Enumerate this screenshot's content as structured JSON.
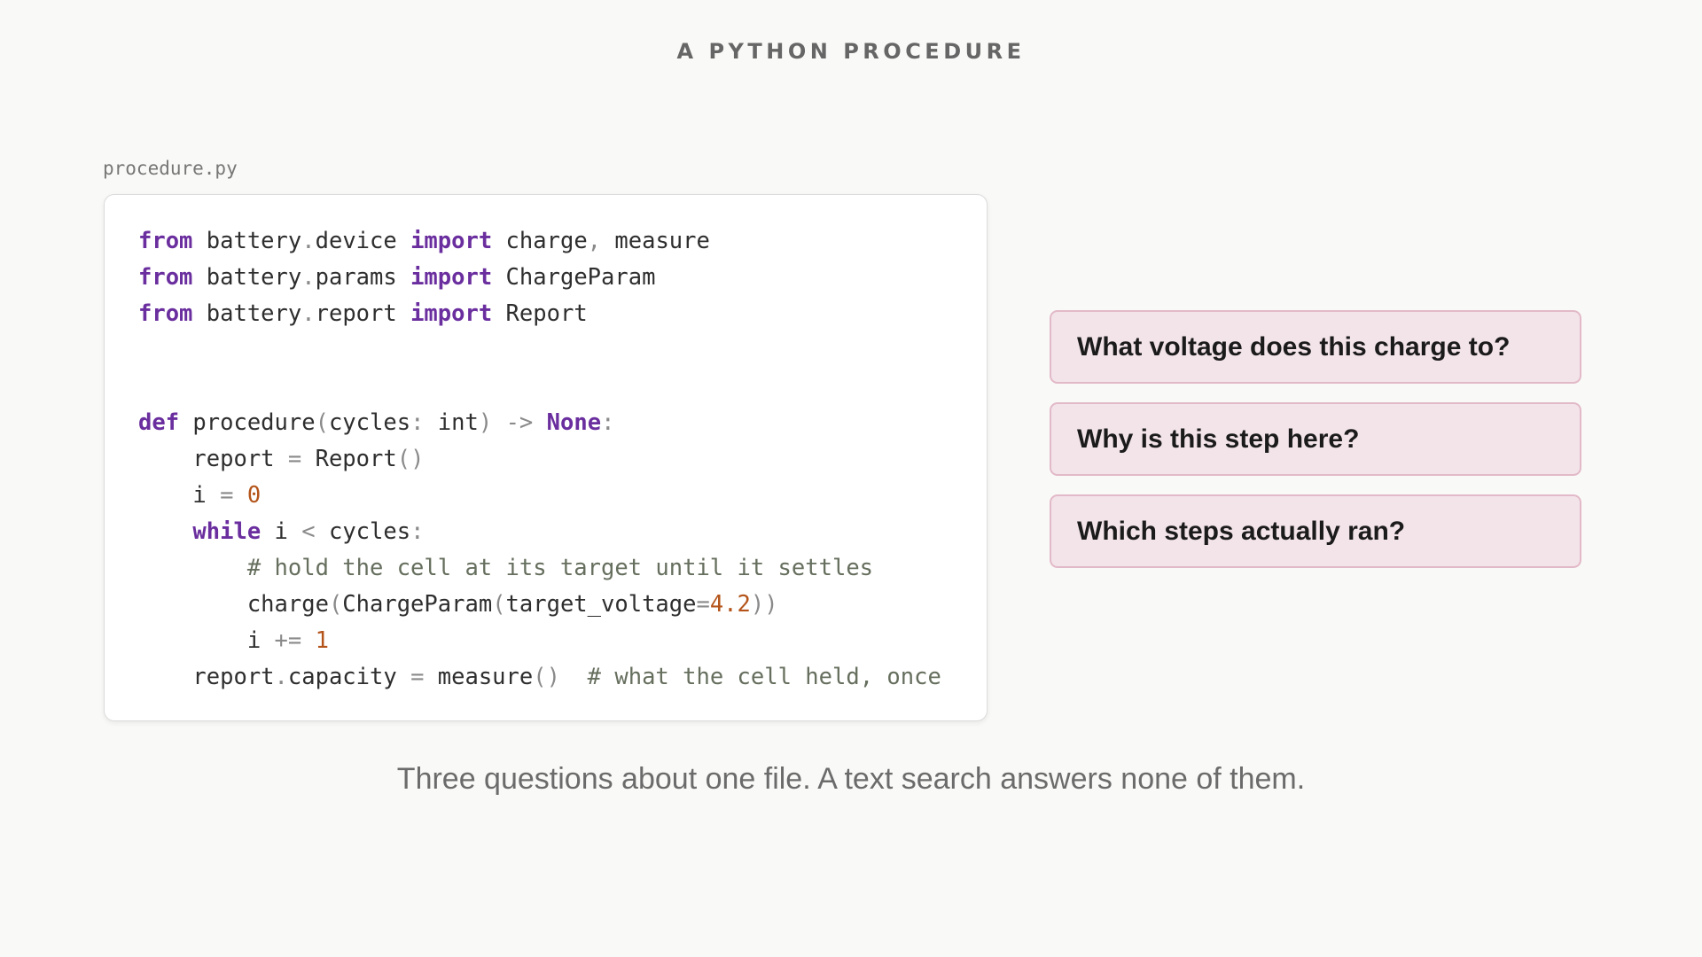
{
  "heading": "A PYTHON PROCEDURE",
  "file": {
    "name": "procedure.py",
    "lines": [
      [
        {
          "t": "from",
          "k": "kw"
        },
        {
          "t": " battery",
          "k": "plain"
        },
        {
          "t": ".",
          "k": "punct"
        },
        {
          "t": "device ",
          "k": "plain"
        },
        {
          "t": "import",
          "k": "kw"
        },
        {
          "t": " charge",
          "k": "plain"
        },
        {
          "t": ",",
          "k": "punct"
        },
        {
          "t": " measure",
          "k": "plain"
        }
      ],
      [
        {
          "t": "from",
          "k": "kw"
        },
        {
          "t": " battery",
          "k": "plain"
        },
        {
          "t": ".",
          "k": "punct"
        },
        {
          "t": "params ",
          "k": "plain"
        },
        {
          "t": "import",
          "k": "kw"
        },
        {
          "t": " ChargeParam",
          "k": "plain"
        }
      ],
      [
        {
          "t": "from",
          "k": "kw"
        },
        {
          "t": " battery",
          "k": "plain"
        },
        {
          "t": ".",
          "k": "punct"
        },
        {
          "t": "report ",
          "k": "plain"
        },
        {
          "t": "import",
          "k": "kw"
        },
        {
          "t": " Report",
          "k": "plain"
        }
      ],
      [],
      [],
      [
        {
          "t": "def",
          "k": "kw"
        },
        {
          "t": " procedure",
          "k": "plain"
        },
        {
          "t": "(",
          "k": "punct"
        },
        {
          "t": "cycles",
          "k": "plain"
        },
        {
          "t": ":",
          "k": "punct"
        },
        {
          "t": " int",
          "k": "plain"
        },
        {
          "t": ")",
          "k": "punct"
        },
        {
          "t": " -> ",
          "k": "punct"
        },
        {
          "t": "None",
          "k": "kw"
        },
        {
          "t": ":",
          "k": "punct"
        }
      ],
      [
        {
          "t": "    report ",
          "k": "plain"
        },
        {
          "t": "=",
          "k": "punct"
        },
        {
          "t": " Report",
          "k": "plain"
        },
        {
          "t": "()",
          "k": "punct"
        }
      ],
      [
        {
          "t": "    i ",
          "k": "plain"
        },
        {
          "t": "=",
          "k": "punct"
        },
        {
          "t": " ",
          "k": "plain"
        },
        {
          "t": "0",
          "k": "num"
        }
      ],
      [
        {
          "t": "    ",
          "k": "plain"
        },
        {
          "t": "while",
          "k": "kw"
        },
        {
          "t": " i ",
          "k": "plain"
        },
        {
          "t": "<",
          "k": "punct"
        },
        {
          "t": " cycles",
          "k": "plain"
        },
        {
          "t": ":",
          "k": "punct"
        }
      ],
      [
        {
          "t": "        # hold the cell at its target until it settles",
          "k": "comment"
        }
      ],
      [
        {
          "t": "        charge",
          "k": "plain"
        },
        {
          "t": "(",
          "k": "punct"
        },
        {
          "t": "ChargeParam",
          "k": "plain"
        },
        {
          "t": "(",
          "k": "punct"
        },
        {
          "t": "target_voltage",
          "k": "plain"
        },
        {
          "t": "=",
          "k": "punct"
        },
        {
          "t": "4.2",
          "k": "num"
        },
        {
          "t": "))",
          "k": "punct"
        }
      ],
      [
        {
          "t": "        i ",
          "k": "plain"
        },
        {
          "t": "+=",
          "k": "punct"
        },
        {
          "t": " ",
          "k": "plain"
        },
        {
          "t": "1",
          "k": "num"
        }
      ],
      [
        {
          "t": "    report",
          "k": "plain"
        },
        {
          "t": ".",
          "k": "punct"
        },
        {
          "t": "capacity ",
          "k": "plain"
        },
        {
          "t": "=",
          "k": "punct"
        },
        {
          "t": " measure",
          "k": "plain"
        },
        {
          "t": "()",
          "k": "punct"
        },
        {
          "t": "  # what the cell held, once",
          "k": "comment"
        }
      ]
    ]
  },
  "questions": [
    "What voltage does this charge to?",
    "Why is this step here?",
    "Which steps actually ran?"
  ],
  "caption": "Three questions about one file. A text search answers none of them.",
  "colors": {
    "keyword": "#6a2e9e",
    "number": "#b4541a",
    "comment": "#666f5e",
    "question_fill": "#f3e4ea",
    "question_border": "#e2b9c8"
  }
}
